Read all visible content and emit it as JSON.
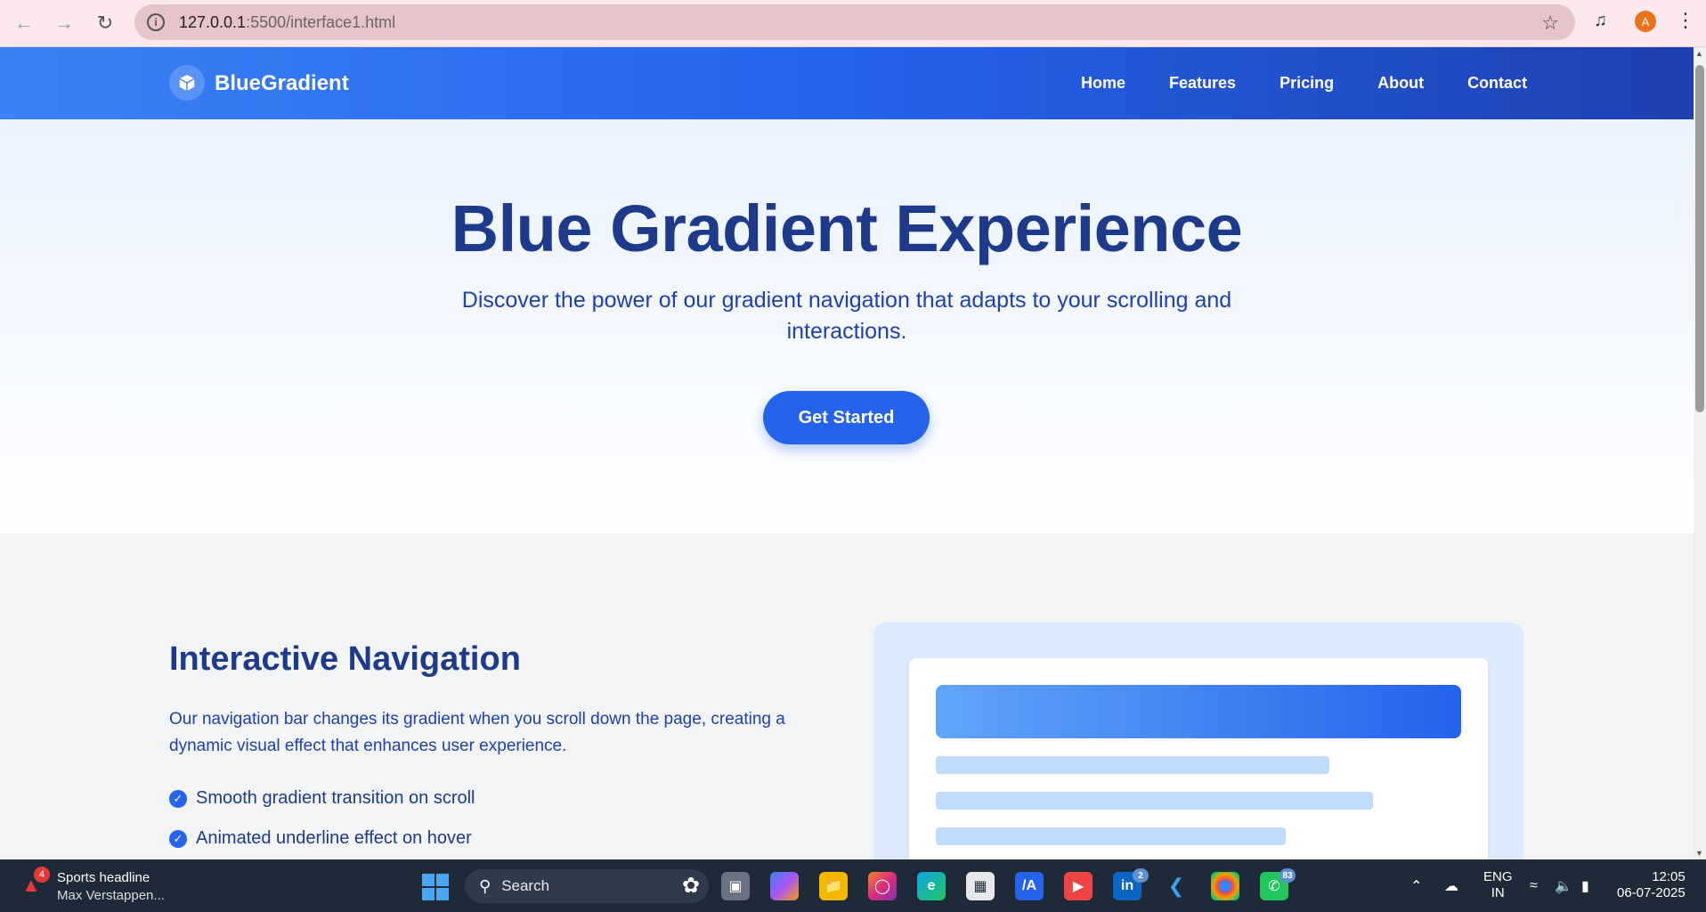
{
  "browser": {
    "url_host": "127.0.0.1",
    "url_path": ":5500/interface1.html",
    "avatar_letter": "A"
  },
  "site": {
    "brand": "BlueGradient",
    "nav": [
      "Home",
      "Features",
      "Pricing",
      "About",
      "Contact"
    ]
  },
  "hero": {
    "title": "Blue Gradient Experience",
    "subtitle": "Discover the power of our gradient navigation that adapts to your scrolling and interactions.",
    "cta": "Get Started"
  },
  "feature": {
    "title": "Interactive Navigation",
    "description": "Our navigation bar changes its gradient when you scroll down the page, creating a dynamic visual effect that enhances user experience.",
    "checklist": [
      "Smooth gradient transition on scroll",
      "Animated underline effect on hover"
    ]
  },
  "taskbar": {
    "news_badge": "4",
    "news_title": "Sports headline",
    "news_sub": "Max Verstappen...",
    "search_label": "Search",
    "linkedin_badge": "2",
    "whatsapp_badge": "83",
    "lang_line1": "ENG",
    "lang_line2": "IN",
    "time": "12:05",
    "date": "06-07-2025"
  },
  "colors": {
    "nav_gradient_start": "#3b82f6",
    "nav_gradient_end": "#1e40af",
    "heading": "#1e3a8a",
    "accent": "#2563eb"
  }
}
